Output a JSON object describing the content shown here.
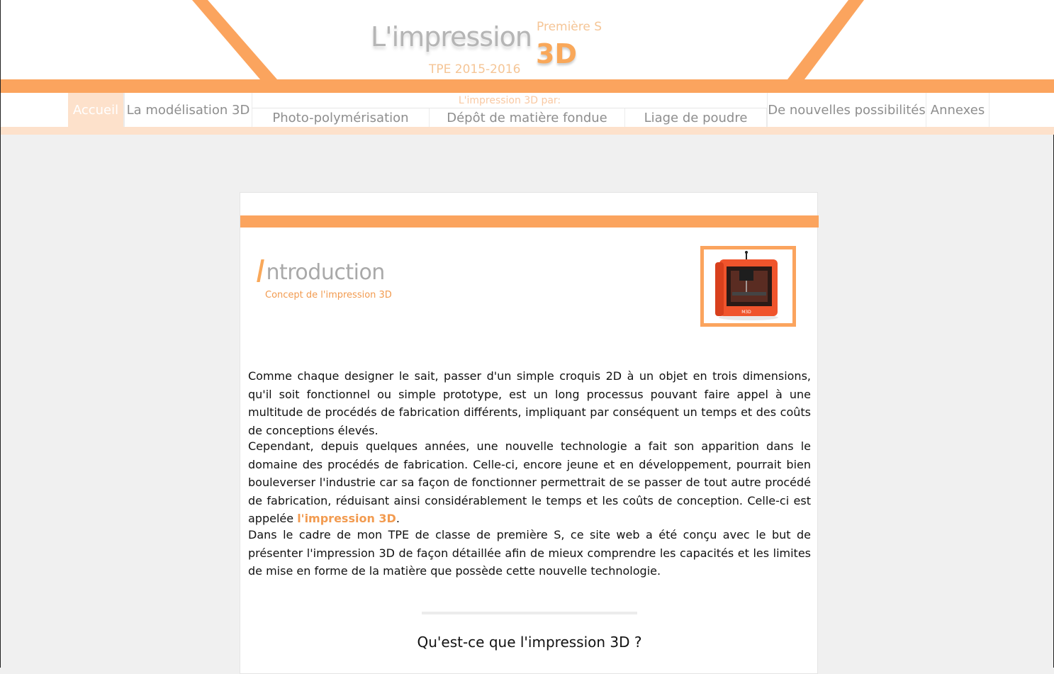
{
  "header": {
    "title": "L'impression",
    "years": "TPE 2015-2016",
    "class": "Première S",
    "title_3d": "3D"
  },
  "nav": {
    "items": [
      {
        "label": "Accueil",
        "active": true
      },
      {
        "label": "La modélisation 3D"
      },
      {
        "label": "De nouvelles possibilités"
      },
      {
        "label": "Annexes"
      }
    ],
    "group_label": "L'impression 3D par:",
    "sub_items": [
      {
        "label": "Photo-polymérisation"
      },
      {
        "label": "Dépôt de matière fondue"
      },
      {
        "label": "Liage de poudre"
      }
    ]
  },
  "content": {
    "intro_title": "ntroduction",
    "intro_initial": "I",
    "intro_subtitle": "Concept de l'impression 3D",
    "image_label": "M3D",
    "paragraphs": [
      "Comme chaque designer le sait, passer d'un simple croquis 2D à un objet en trois dimensions, qu'il soit fonctionnel ou simple prototype, est un long processus pouvant faire appel à une multitude de procédés de fabrication différents, impliquant par conséquent un temps et des coûts de conceptions élevés.",
      "Cependant, depuis quelques années, une nouvelle technologie a fait son apparition dans le domaine des procédés de fabrication. Celle-ci, encore jeune et en développement, pourrait bien bouleverser l'industrie car sa façon de fonctionner permettrait de se passer de tout autre procédé de fabrication, réduisant ainsi considérablement le temps et les coûts de conception. Celle-ci est appelée",
      "Dans le cadre de mon TPE de classe de première S, ce site web a été conçu avec le but de présenter l'impression 3D de façon détaillée afin de mieux comprendre les capacités et les limites de mise en forme de la matière que possède cette nouvelle technologie."
    ],
    "highlight": "l'impression 3D",
    "period": ".",
    "section_heading": "Qu'est-ce que l'impression 3D ?"
  },
  "colors": {
    "accent": "#fba45e",
    "accent_light": "#fde1cb",
    "background": "#f0f0f0",
    "text": "#111111"
  }
}
